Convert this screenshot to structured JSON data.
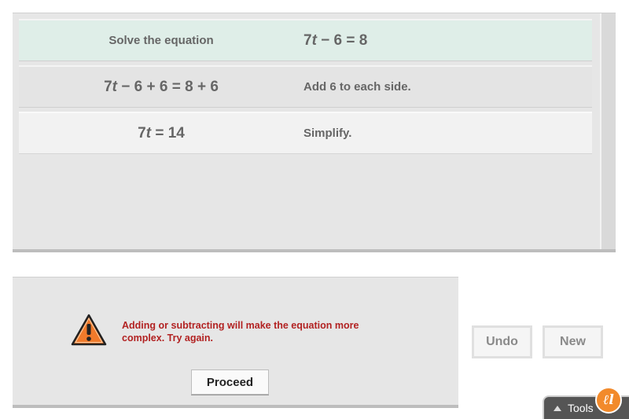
{
  "steps": [
    {
      "left": {
        "kind": "label",
        "text": "Solve the equation"
      },
      "right": {
        "kind": "eq",
        "parts": [
          "7",
          "t",
          " − 6 = 8"
        ]
      }
    },
    {
      "left": {
        "kind": "eq",
        "parts": [
          "7",
          "t",
          " − 6 + 6 = 8 + 6"
        ]
      },
      "right": {
        "kind": "label",
        "text": "Add 6 to each side."
      }
    },
    {
      "left": {
        "kind": "eq",
        "parts": [
          "7",
          "t",
          " = 14"
        ]
      },
      "right": {
        "kind": "label",
        "text": "Simplify."
      }
    }
  ],
  "feedback": {
    "icon": "warning-icon",
    "message": "Adding or subtracting will make the equation more complex. Try again.",
    "proceed_label": "Proceed",
    "icon_color": "#f07a2b"
  },
  "controls": {
    "undo_label": "Undo",
    "new_label": "New"
  },
  "tools": {
    "label": "Tools",
    "logo_text": "ℓl"
  }
}
